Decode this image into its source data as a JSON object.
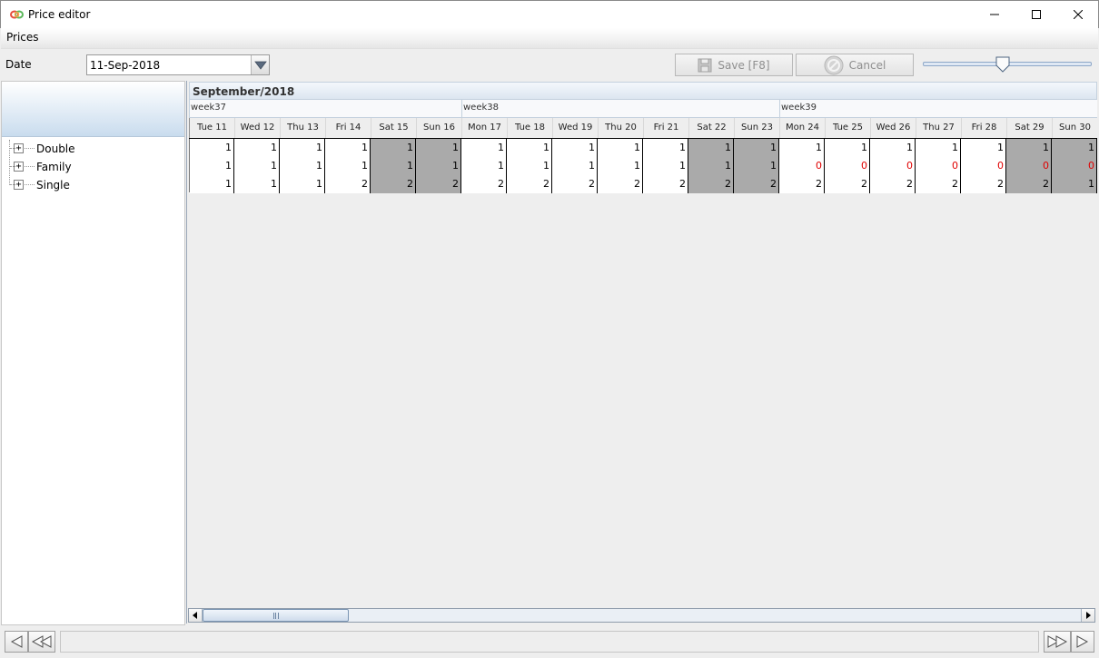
{
  "window": {
    "title": "Price editor",
    "controls": {
      "minimize": "—",
      "maximize": "☐",
      "close": "✕"
    }
  },
  "menu": {
    "items": [
      "Prices"
    ]
  },
  "toolbar": {
    "date_label": "Date",
    "date_value": "11-Sep-2018",
    "save_label": "Save [F8]",
    "cancel_label": "Cancel",
    "zoom_level": 0.47
  },
  "tree": {
    "items": [
      {
        "label": "Double",
        "expander": "+"
      },
      {
        "label": "Family",
        "expander": "+"
      },
      {
        "label": "Single",
        "expander": "+"
      }
    ]
  },
  "grid": {
    "month": "September/2018",
    "weeks": [
      "week37",
      "week38",
      "week39"
    ],
    "days": [
      "Tue 11",
      "Wed 12",
      "Thu 13",
      "Fri 14",
      "Sat 15",
      "Sun 16",
      "Mon 17",
      "Tue 18",
      "Wed 19",
      "Thu 20",
      "Fri 21",
      "Sat 22",
      "Sun 23",
      "Mon 24",
      "Tue 25",
      "Wed 26",
      "Thu 27",
      "Fri 28",
      "Sat 29",
      "Sun 30"
    ],
    "weekend_columns": [
      4,
      5,
      11,
      12,
      18,
      19
    ],
    "rows": [
      {
        "name": "Double",
        "values": [
          "1",
          "1",
          "1",
          "1",
          "1",
          "1",
          "1",
          "1",
          "1",
          "1",
          "1",
          "1",
          "1",
          "1",
          "1",
          "1",
          "1",
          "1",
          "1",
          "1"
        ]
      },
      {
        "name": "Family",
        "values": [
          "1",
          "1",
          "1",
          "1",
          "1",
          "1",
          "1",
          "1",
          "1",
          "1",
          "1",
          "1",
          "1",
          "0",
          "0",
          "0",
          "0",
          "0",
          "0",
          "0"
        ]
      },
      {
        "name": "Single",
        "values": [
          "1",
          "1",
          "1",
          "2",
          "2",
          "2",
          "2",
          "2",
          "2",
          "2",
          "2",
          "2",
          "2",
          "2",
          "2",
          "2",
          "2",
          "2",
          "2",
          "1"
        ]
      }
    ],
    "highlight_color": "#e00000",
    "weekend_color": "#aaaaaa"
  },
  "icons": {
    "app": "app-rings-icon",
    "save": "floppy-disk-icon",
    "cancel": "cancel-circle-icon",
    "dropdown": "chevron-down-icon",
    "nav_first": "nav-first-icon",
    "nav_prev": "nav-prev-icon",
    "nav_next": "nav-next-icon",
    "nav_last": "nav-last-icon"
  }
}
